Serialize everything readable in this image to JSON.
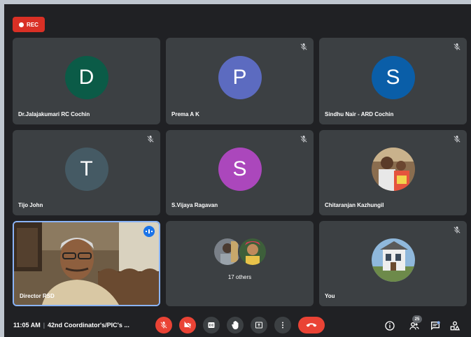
{
  "recording": {
    "label": "REC"
  },
  "tiles": [
    {
      "name": "Dr.Jalajakumari RC Cochin",
      "initial": "D",
      "color": "#0b5b47"
    },
    {
      "name": "Prema A K",
      "initial": "P",
      "color": "#5c6bc0"
    },
    {
      "name": "Sindhu Nair - ARD Cochin",
      "initial": "S",
      "color": "#0a5ea8"
    },
    {
      "name": "Tijo John",
      "initial": "T",
      "color": "#455a64"
    },
    {
      "name": "S.Vijaya Ragavan",
      "initial": "S",
      "color": "#ab47bc"
    },
    {
      "name": "Chitaranjan Kazhungil"
    },
    {
      "name": "Director RSD"
    },
    {
      "others_label": "17 others"
    },
    {
      "name": "You"
    }
  ],
  "bottom_bar": {
    "time": "11:05 AM",
    "separator": "|",
    "meeting_title": "42nd Coordinator's/PIC's ...",
    "participant_count": "25"
  }
}
